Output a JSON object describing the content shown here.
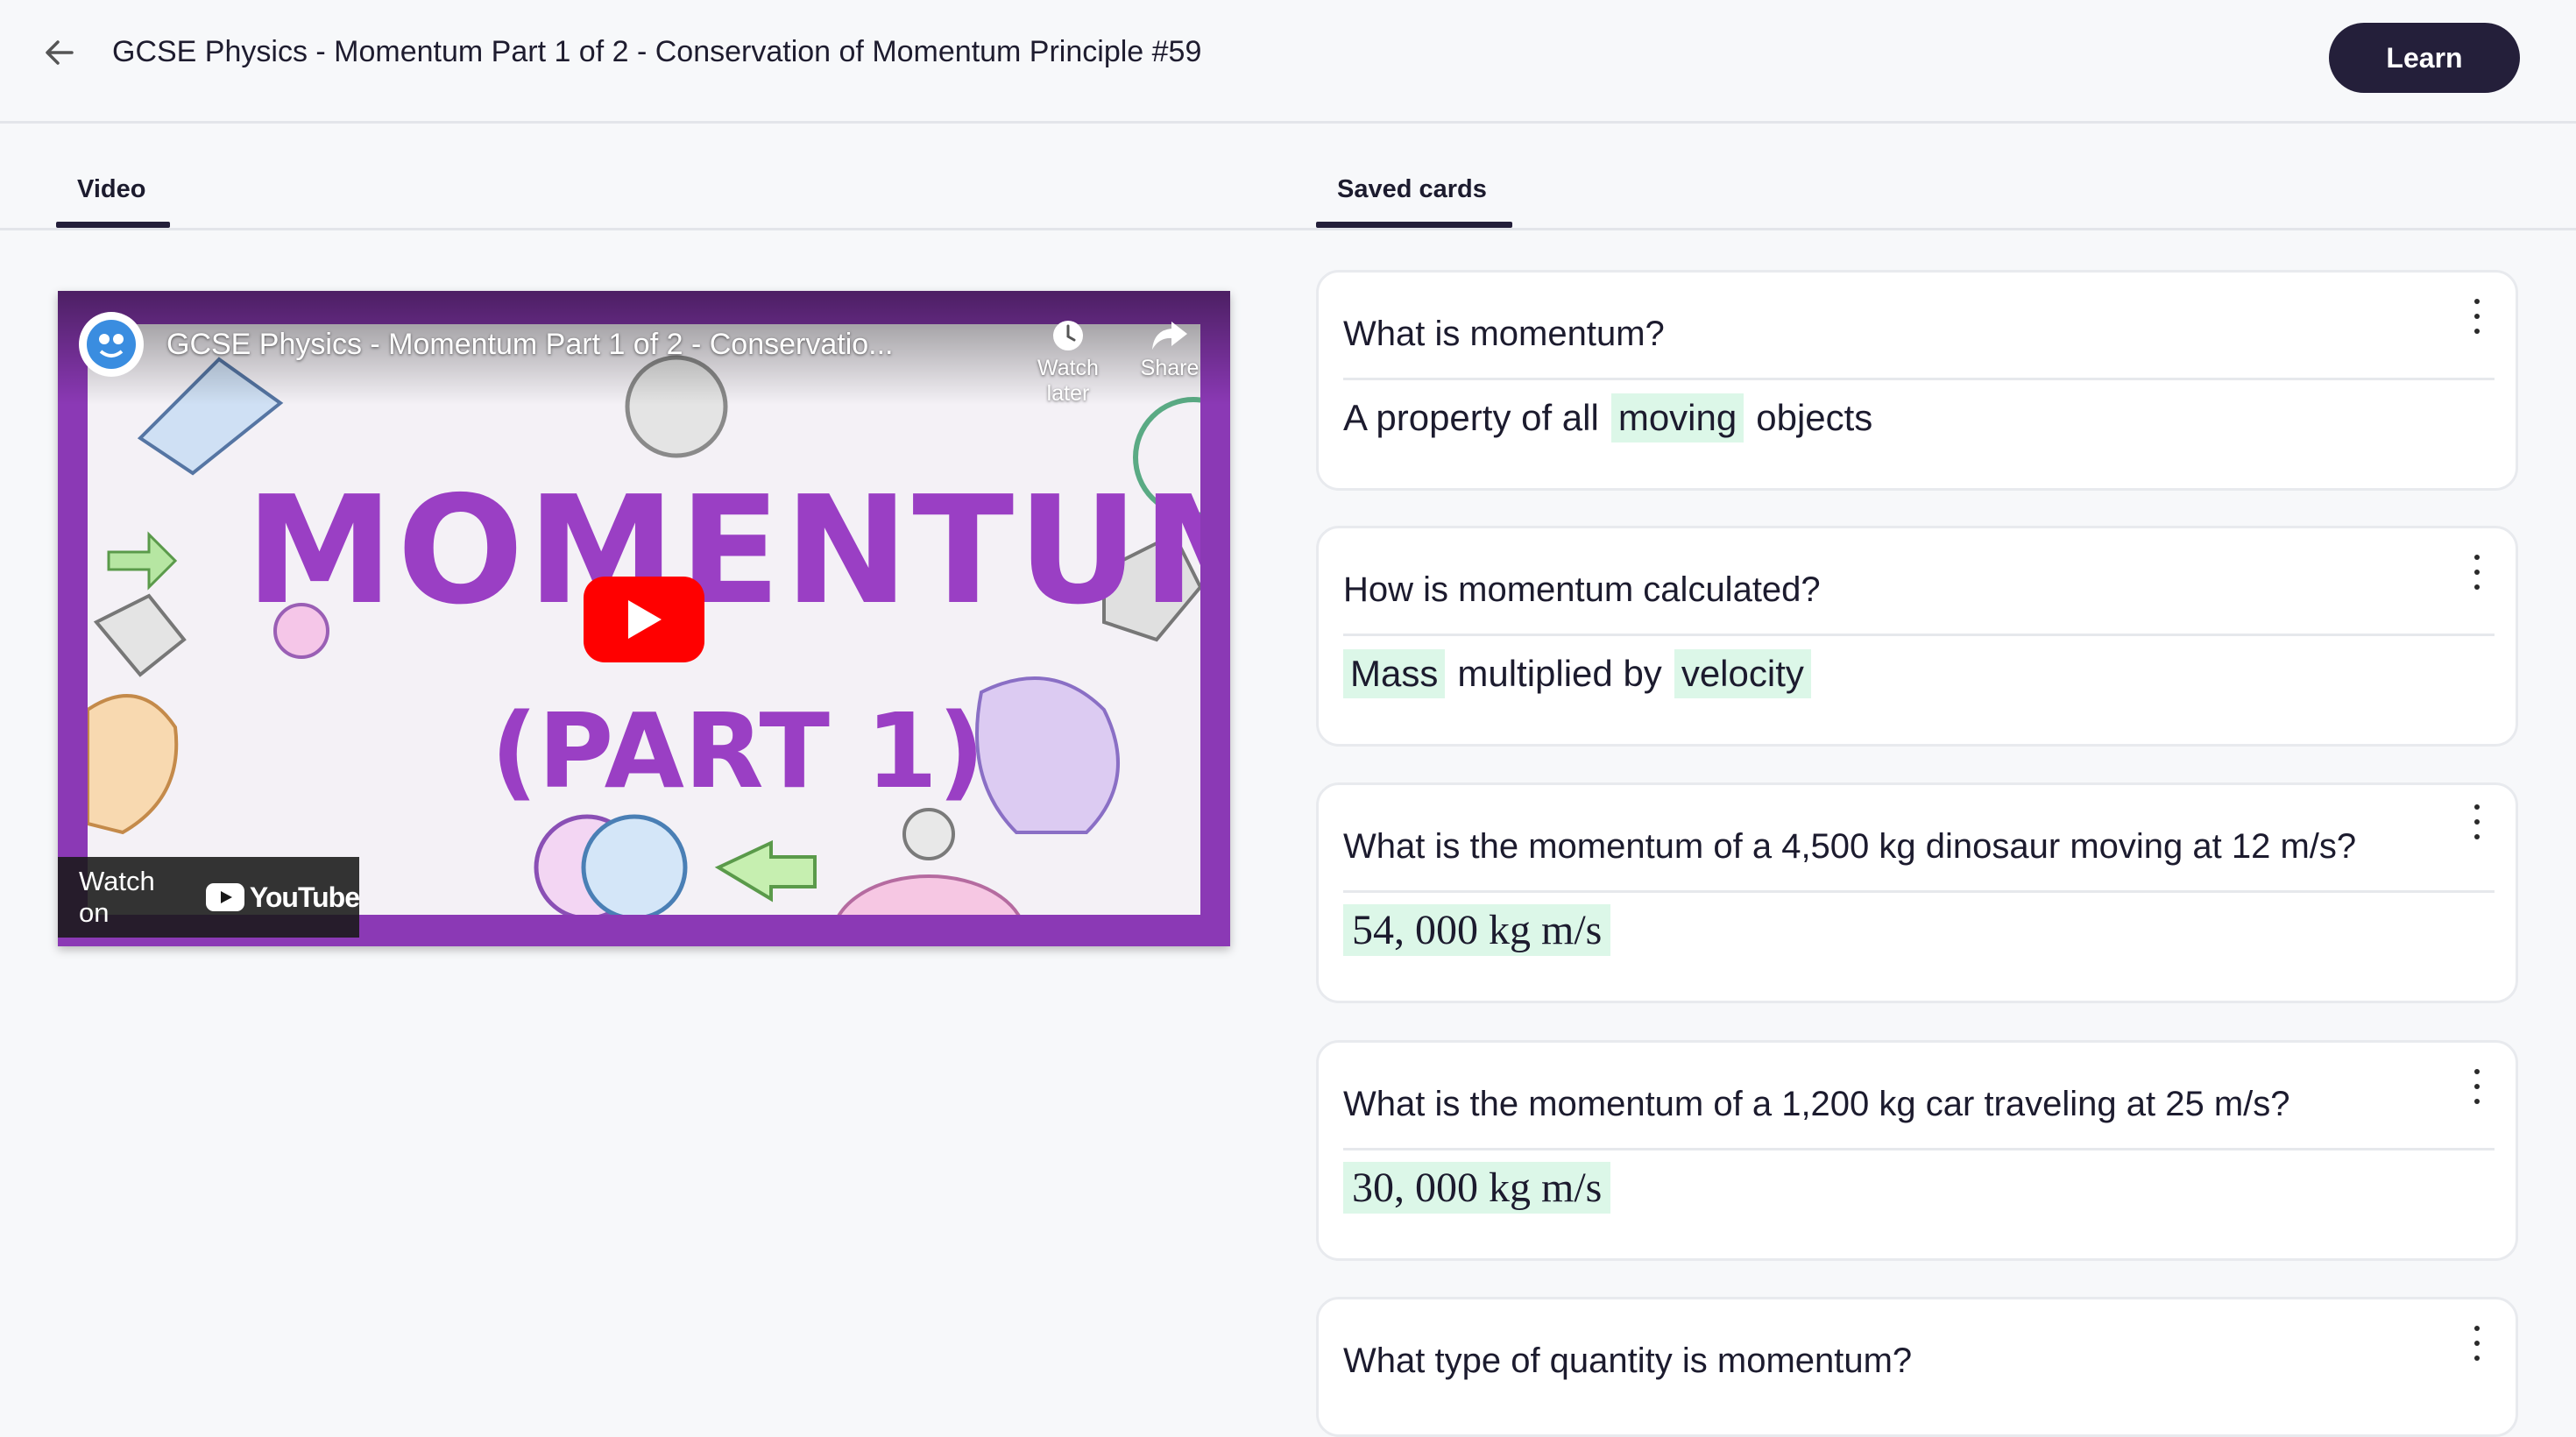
{
  "header": {
    "title": "GCSE Physics - Momentum Part 1 of 2 - Conservation of Momentum Principle #59",
    "learn_label": "Learn"
  },
  "tabs": [
    {
      "label": "Video"
    },
    {
      "label": "Saved cards"
    }
  ],
  "video": {
    "title": "GCSE Physics - Momentum Part 1 of 2 - Conservatio...",
    "watch_later": "Watch later",
    "share": "Share",
    "thumbnail_title": "MOMENTUM",
    "thumbnail_subtitle": "(PART 1)",
    "watch_on": "Watch on",
    "youtube": "YouTube"
  },
  "cards": [
    {
      "question": "What is momentum?",
      "answer_parts": [
        {
          "text": "A property of all",
          "highlight": false
        },
        {
          "text": "moving",
          "highlight": true
        },
        {
          "text": "objects",
          "highlight": false
        }
      ]
    },
    {
      "question": "How is momentum calculated?",
      "answer_parts": [
        {
          "text": "Mass",
          "highlight": true
        },
        {
          "text": "multiplied by",
          "highlight": false
        },
        {
          "text": "velocity",
          "highlight": true
        }
      ]
    },
    {
      "question": "What is the momentum of a 4,500 kg dinosaur moving at 12 m/s?",
      "answer_math": "54, 000 kg m/s"
    },
    {
      "question": "What is the momentum of a 1,200 kg car traveling at 25 m/s?",
      "answer_math": "30, 000 kg m/s"
    },
    {
      "question": "What type of quantity is momentum?"
    }
  ],
  "colors": {
    "primary": "#241f3a",
    "highlight": "#dcf7e8",
    "video_frame": "#8b39b5",
    "youtube_red": "#ff0000"
  }
}
